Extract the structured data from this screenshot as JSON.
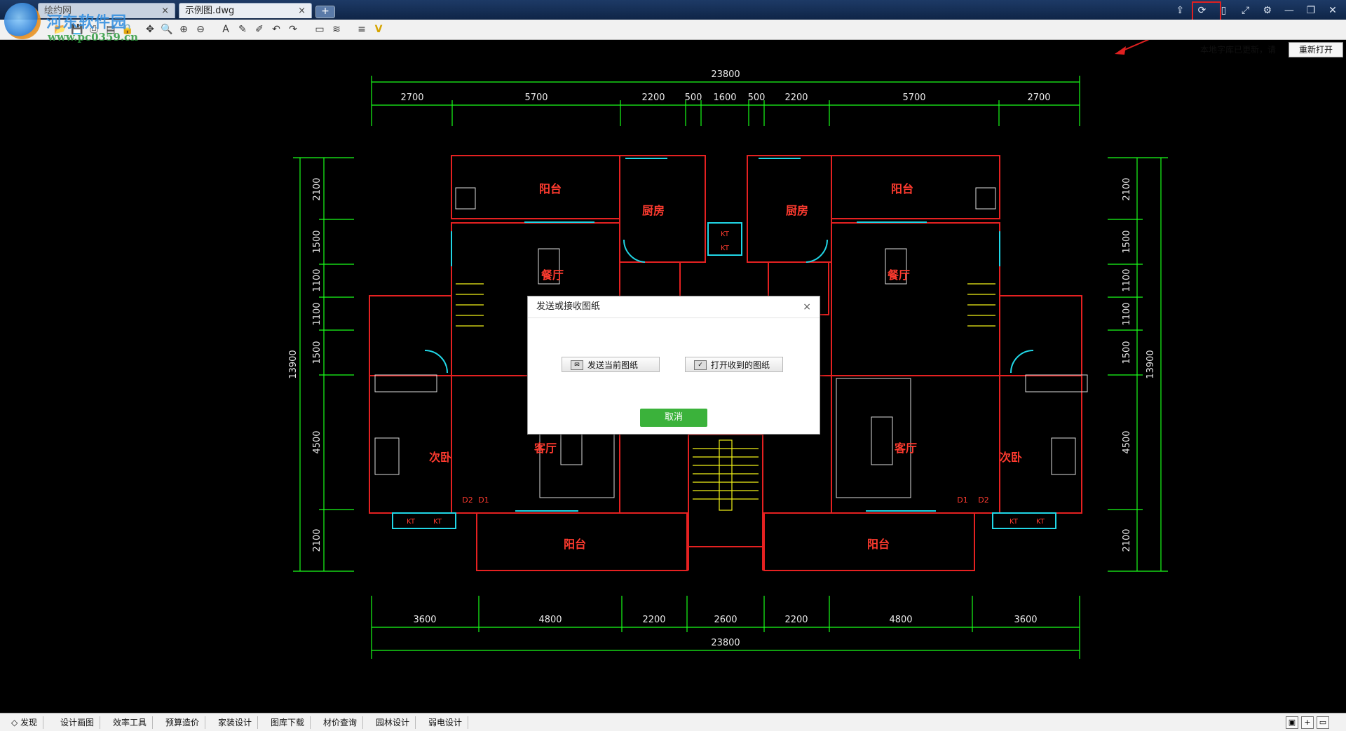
{
  "titlebar": {
    "home_tab_label": "绘约网",
    "file_tab_label": "示例图.dwg",
    "tab_close": "×",
    "add_tab": "+",
    "minimize": "—",
    "restore": "❐",
    "close": "✕"
  },
  "watermark": {
    "name": "河东软件园",
    "url": "www.pc0359.cn"
  },
  "toolbar": {
    "notice": "本地字库已更新，请",
    "reopen_label": "重新打开"
  },
  "drawing": {
    "top_total": "23800",
    "top_dims": [
      "2700",
      "5700",
      "2200",
      "500",
      "1600",
      "500",
      "2200",
      "5700",
      "2700"
    ],
    "bottom_total": "23800",
    "bottom_dims": [
      "3600",
      "4800",
      "2200",
      "2600",
      "2200",
      "4800",
      "3600"
    ],
    "left_dims": [
      "2100",
      "1500",
      "1100",
      "1100",
      "1500",
      "4500",
      "2100"
    ],
    "left_total": "13900",
    "right_dims": [
      "2100",
      "1500",
      "1100",
      "1100",
      "1500",
      "4500",
      "2100"
    ],
    "right_total": "13900",
    "rooms": {
      "balcony": "阳台",
      "kitchen": "厨房",
      "dining": "餐厅",
      "living": "客厅",
      "bedroom": "次卧"
    },
    "tags": {
      "kt": "KT",
      "d1": "D1",
      "d2": "D2"
    }
  },
  "dialog": {
    "title": "发送或接收图纸",
    "send_label": "发送当前图纸",
    "open_label": "打开收到的图纸",
    "cancel_label": "取消",
    "close": "×"
  },
  "statusbar": {
    "tabs": [
      "发现",
      "设计画图",
      "效率工具",
      "预算造价",
      "家装设计",
      "图库下载",
      "材价查询",
      "园林设计",
      "弱电设计"
    ]
  },
  "colors": {
    "dim_line": "#19ff19",
    "wall": "#ff2020",
    "cyan": "#21d6e6",
    "yellow": "#f2f218",
    "room_text": "#ff3b2f",
    "highlight": "#e02020"
  }
}
